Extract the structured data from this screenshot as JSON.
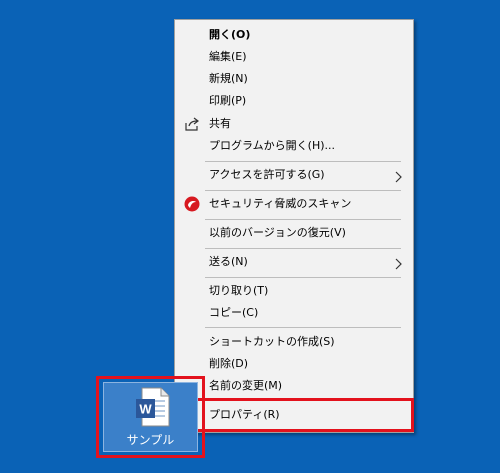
{
  "desktop": {
    "file": {
      "label": "サンプル",
      "icon": "word-document-icon",
      "icon_letter": "W"
    }
  },
  "menu": {
    "items": [
      {
        "label": "開く(O)",
        "bold": true
      },
      {
        "label": "編集(E)"
      },
      {
        "label": "新規(N)"
      },
      {
        "label": "印刷(P)"
      },
      {
        "label": "共有",
        "icon": "share-icon"
      },
      {
        "label": "プログラムから開く(H)..."
      },
      {
        "label": "アクセスを許可する(G)",
        "submenu": true
      },
      {
        "label": "セキュリティ脅威のスキャン",
        "icon": "security-scan-icon"
      },
      {
        "label": "以前のバージョンの復元(V)"
      },
      {
        "label": "送る(N)",
        "submenu": true
      },
      {
        "label": "切り取り(T)"
      },
      {
        "label": "コピー(C)"
      },
      {
        "label": "ショートカットの作成(S)"
      },
      {
        "label": "削除(D)"
      },
      {
        "label": "名前の変更(M)"
      },
      {
        "label": "プロパティ(R)"
      }
    ]
  },
  "colors": {
    "desktop_bg": "#0a62b6",
    "menu_bg": "#f2f2f2",
    "highlight_border": "#e3121d",
    "word_blue": "#2b579a",
    "security_red": "#d71920"
  }
}
